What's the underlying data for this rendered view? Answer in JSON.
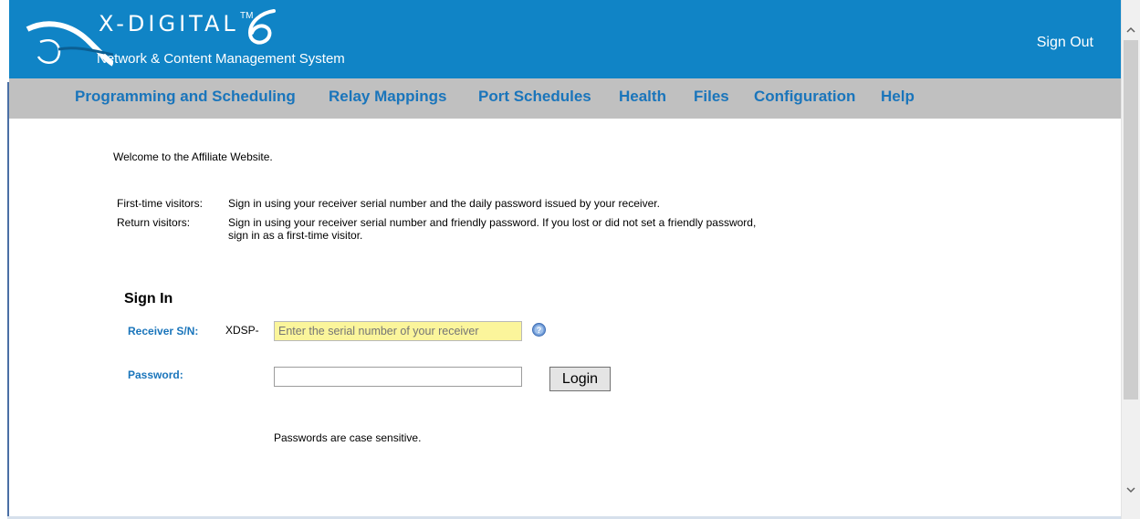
{
  "header": {
    "logo_title": "X-DIGITAL",
    "logo_tm": "TM",
    "logo_subtitle": "Network & Content Management System",
    "sign_out_label": "Sign Out"
  },
  "nav": {
    "items": [
      {
        "label": "Programming and Scheduling"
      },
      {
        "label": "Relay Mappings"
      },
      {
        "label": "Port Schedules"
      },
      {
        "label": "Health"
      },
      {
        "label": "Files"
      },
      {
        "label": "Configuration"
      },
      {
        "label": "Help"
      }
    ]
  },
  "content": {
    "welcome": "Welcome to the Affiliate Website.",
    "first_time_label": "First-time visitors:",
    "first_time_text": "Sign in using your receiver serial number and the daily password issued by your receiver.",
    "return_label": "Return visitors:",
    "return_text": "Sign in using your receiver serial number and friendly password. If you lost or did not set a friendly password, sign in as a first-time visitor."
  },
  "signin": {
    "title": "Sign In",
    "receiver_label": "Receiver S/N:",
    "prefix": "XDSP-",
    "serial_placeholder": "Enter the serial number of your receiver",
    "password_label": "Password:",
    "password_value": "",
    "login_label": "Login",
    "note": "Passwords are case sensitive."
  },
  "colors": {
    "header_bg": "#1084c6",
    "nav_bg": "#c0c0c0",
    "link": "#1a75bb",
    "serial_field_bg": "#fbf59b"
  },
  "icons": {
    "help": "help-icon",
    "logo": "xdigital-logo-icon"
  }
}
